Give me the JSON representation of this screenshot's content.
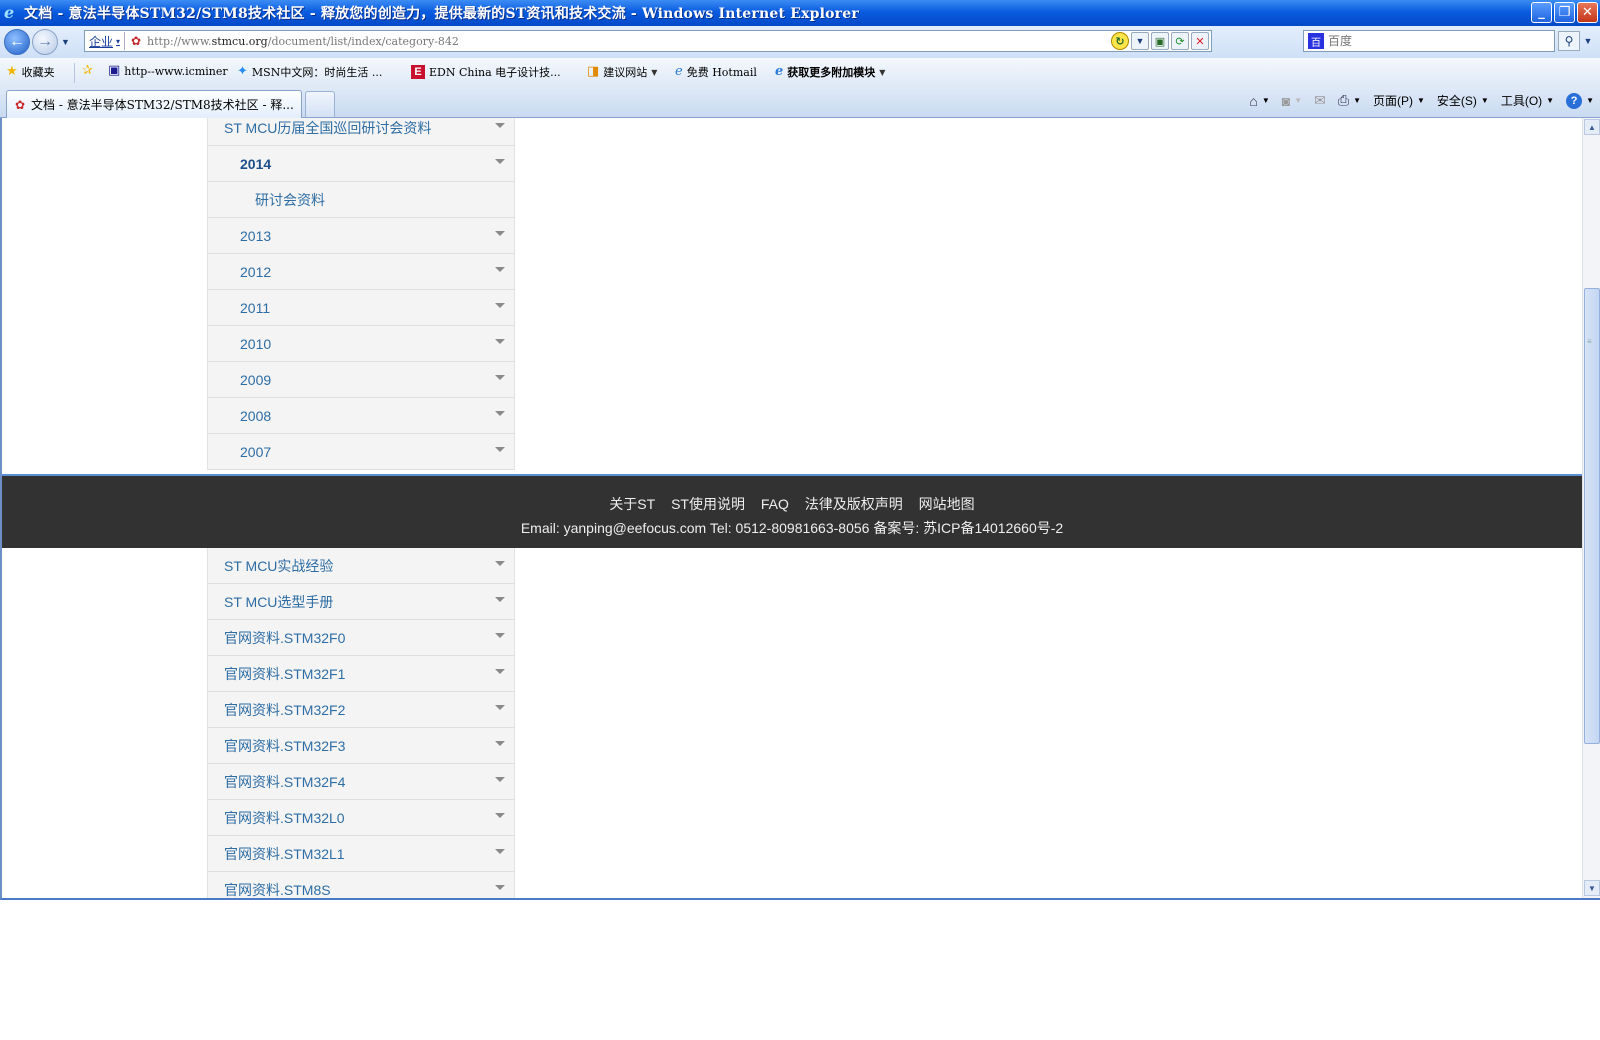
{
  "window": {
    "title": "文档 - 意法半导体STM32/STM8技术社区 - 释放您的创造力，提供最新的ST资讯和技术交流 - Windows Internet Explorer"
  },
  "address_bar": {
    "zone": "企业",
    "url_prefix": "http://www.",
    "url_host": "stmcu.org",
    "url_path": "/document/list/index/category-842",
    "search_placeholder": "百度"
  },
  "favorites": {
    "label": "收藏夹",
    "items": [
      {
        "label": "http--www.icminer",
        "icon": "ic-icon"
      },
      {
        "label": "MSN中文网：时尚生活 ...",
        "icon": "msn-icon"
      },
      {
        "label": "EDN China 电子设计技...",
        "icon": "edn-icon"
      },
      {
        "label": "建议网站",
        "icon": "suggested-sites-icon"
      },
      {
        "label": "免费 Hotmail",
        "icon": "ie-icon"
      },
      {
        "label": "获取更多附加模块",
        "icon": "ie-icon"
      }
    ]
  },
  "tab": {
    "label": "文档 - 意法半导体STM32/STM8技术社区 - 释..."
  },
  "commands": {
    "page": "页面(P)",
    "safety": "安全(S)",
    "tools": "工具(O)"
  },
  "menu_top": [
    {
      "label": "ST MCU历届全国巡回研讨会资料",
      "level": 0,
      "active": false,
      "expandable": true
    },
    {
      "label": "2014",
      "level": 1,
      "active": true,
      "expandable": true
    },
    {
      "label": "研讨会资料",
      "level": 2,
      "active": false,
      "expandable": false
    },
    {
      "label": "2013",
      "level": 1,
      "active": false,
      "expandable": true
    },
    {
      "label": "2012",
      "level": 1,
      "active": false,
      "expandable": true
    },
    {
      "label": "2011",
      "level": 1,
      "active": false,
      "expandable": true
    },
    {
      "label": "2010",
      "level": 1,
      "active": false,
      "expandable": true
    },
    {
      "label": "2009",
      "level": 1,
      "active": false,
      "expandable": true
    },
    {
      "label": "2008",
      "level": 1,
      "active": false,
      "expandable": true
    },
    {
      "label": "2007",
      "level": 1,
      "active": false,
      "expandable": true
    }
  ],
  "footer": {
    "links": [
      "关于ST",
      "ST使用说明",
      "FAQ",
      "法律及版权声明",
      "网站地图"
    ],
    "contact": "Email:  yanping@eefocus.com   Tel: 0512-80981663-8056 备案号: 苏ICP备14012660号-2"
  },
  "menu_bottom": [
    {
      "label": "ST MCU实战经验",
      "level": 0,
      "active": false,
      "expandable": true
    },
    {
      "label": "ST MCU选型手册",
      "level": 0,
      "active": false,
      "expandable": true
    },
    {
      "label": "官网资料.STM32F0",
      "level": 0,
      "active": false,
      "expandable": true
    },
    {
      "label": "官网资料.STM32F1",
      "level": 0,
      "active": false,
      "expandable": true
    },
    {
      "label": "官网资料.STM32F2",
      "level": 0,
      "active": false,
      "expandable": true
    },
    {
      "label": "官网资料.STM32F3",
      "level": 0,
      "active": false,
      "expandable": true
    },
    {
      "label": "官网资料.STM32F4",
      "level": 0,
      "active": false,
      "expandable": true
    },
    {
      "label": "官网资料.STM32L0",
      "level": 0,
      "active": false,
      "expandable": true
    },
    {
      "label": "官网资料.STM32L1",
      "level": 0,
      "active": false,
      "expandable": true
    },
    {
      "label": "官网资料.STM8S",
      "level": 0,
      "active": false,
      "expandable": true
    }
  ],
  "colors": {
    "link": "#2e6da4",
    "menu_bg": "#f4f4f4",
    "footer_bg": "#323232",
    "titlebar": "#0a5ce0"
  }
}
